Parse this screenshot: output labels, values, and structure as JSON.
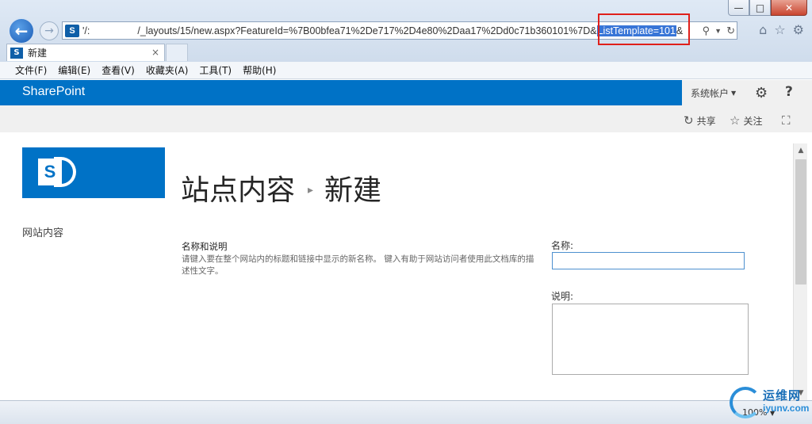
{
  "browser": {
    "window_controls": {
      "minimize": "—",
      "maximize": "□",
      "close": "✕"
    },
    "address": {
      "prefix": "'/:",
      "url_main": "/_layouts/15/new.aspx?FeatureId=%7B00bfea71%2De717%2D4e80%2Daa17%2Dd0c71b360101%7D&",
      "url_highlight": "ListTemplate=101",
      "url_tail": "&"
    },
    "tab": {
      "title": "新建",
      "close": "×"
    },
    "icons": {
      "back": "back-arrow-icon",
      "forward": "forward-arrow-icon",
      "home": "home-icon",
      "favorites": "star-icon",
      "tools": "gear-icon"
    }
  },
  "menu": {
    "items": [
      "文件(F)",
      "编辑(E)",
      "查看(V)",
      "收藏夹(A)",
      "工具(T)",
      "帮助(H)"
    ]
  },
  "suitebar": {
    "brand": "SharePoint",
    "account": "系统帐户",
    "help": "?"
  },
  "ribbon": {
    "share": "共享",
    "follow": "关注"
  },
  "page": {
    "title": "站点内容",
    "subtitle": "新建",
    "left_nav": "网站内容",
    "section_title": "名称和说明",
    "section_desc": "请键入要在整个网站内的标题和链接中显示的新名称。 键入有助于网站访问者使用此文档库的描述性文字。",
    "name_label": "名称:",
    "name_value": "",
    "desc_label": "说明:",
    "desc_value": ""
  },
  "status": {
    "zoom": "100%"
  },
  "watermark": {
    "text": "运维网",
    "url": "iyunv.com"
  },
  "colors": {
    "suite_blue": "#0072c6",
    "highlight_red": "#e0201b",
    "selection_blue": "#3875d7"
  }
}
